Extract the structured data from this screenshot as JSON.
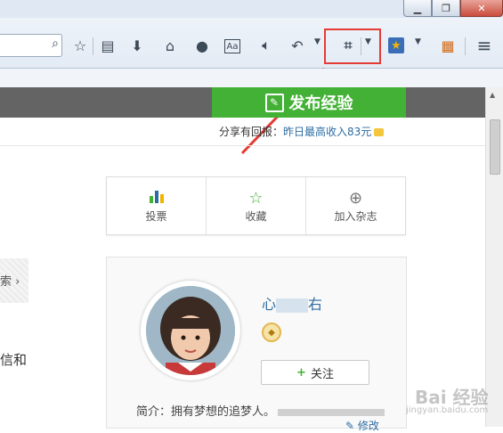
{
  "toolbar": {
    "icons": [
      "bookmark-star-icon",
      "reading-list-icon",
      "download-icon",
      "home-icon",
      "chat-icon",
      "reader-mode-icon",
      "speaker-icon",
      "undo-icon",
      "crop-icon",
      "favorite-star-icon",
      "gallery-icon",
      "menu-icon"
    ]
  },
  "colors": {
    "accent": "#42b135",
    "highlight_box": "#e63b35",
    "link": "#2d6ca2",
    "nav": "#646464"
  },
  "page": {
    "publish_label": "发布经验",
    "share_prefix": "分享有回报：",
    "share_highlight": "昨日最高收入83元",
    "actions": [
      {
        "label": "投票"
      },
      {
        "label": "收藏"
      },
      {
        "label": "加入杂志"
      }
    ],
    "left_text_1": "索",
    "left_text_2": "信和",
    "profile": {
      "name_prefix": "心",
      "name_suffix": "右",
      "follow_label": "关注",
      "intro_label": "简介：",
      "intro_text": "拥有梦想的追梦人。",
      "edit_label": "修改"
    },
    "watermark": "Bai 经验",
    "watermark_url": "jingyan.baidu.com"
  }
}
